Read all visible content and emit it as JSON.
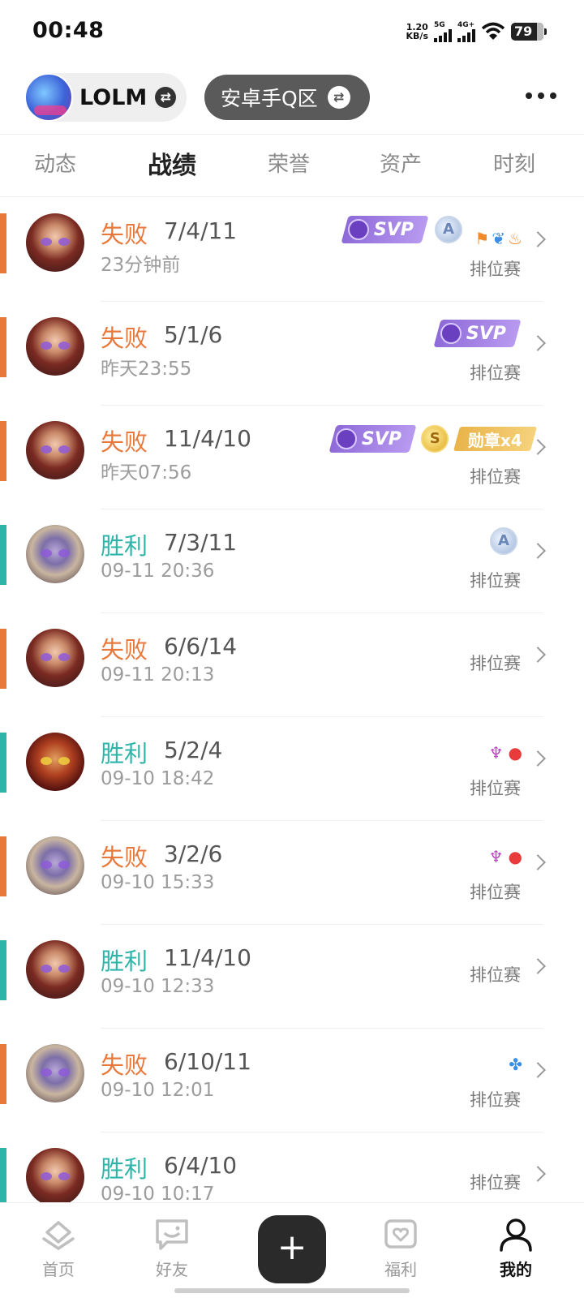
{
  "status_bar": {
    "time": "00:48",
    "net_speed": "1.20",
    "net_unit": "KB/s",
    "sim1": "5G",
    "sim2": "4G+",
    "battery": "79"
  },
  "header": {
    "game_name": "LOLM",
    "swap_glyph": "⇄",
    "server": "安卓手Q区",
    "more_icon": "more-horizontal-icon"
  },
  "tabs": [
    {
      "label": "动态",
      "active": false
    },
    {
      "label": "战绩",
      "active": true
    },
    {
      "label": "荣誉",
      "active": false
    },
    {
      "label": "资产",
      "active": false
    },
    {
      "label": "时刻",
      "active": false
    }
  ],
  "matches": [
    {
      "result": "失败",
      "kda": "7/4/11",
      "time": "23分钟前",
      "mode": "排位赛",
      "svp_text": "SVP",
      "coin_letter": "A"
    },
    {
      "result": "失败",
      "kda": "5/1/6",
      "time": "昨天23:55",
      "mode": "排位赛",
      "svp_text": "SVP"
    },
    {
      "result": "失败",
      "kda": "11/4/10",
      "time": "昨天07:56",
      "mode": "排位赛",
      "svp_text": "SVP",
      "coin_letter": "S",
      "medal_text": "勋章x4"
    },
    {
      "result": "胜利",
      "kda": "7/3/11",
      "time": "09-11 20:36",
      "mode": "排位赛",
      "coin_letter": "A"
    },
    {
      "result": "失败",
      "kda": "6/6/14",
      "time": "09-11 20:13",
      "mode": "排位赛"
    },
    {
      "result": "胜利",
      "kda": "5/2/4",
      "time": "09-10 18:42",
      "mode": "排位赛"
    },
    {
      "result": "失败",
      "kda": "3/2/6",
      "time": "09-10 15:33",
      "mode": "排位赛"
    },
    {
      "result": "胜利",
      "kda": "11/4/10",
      "time": "09-10 12:33",
      "mode": "排位赛"
    },
    {
      "result": "失败",
      "kda": "6/10/11",
      "time": "09-10 12:01",
      "mode": "排位赛"
    },
    {
      "result": "胜利",
      "kda": "6/4/10",
      "time": "09-10 10:17",
      "mode": "排位赛"
    }
  ],
  "colors": {
    "loss": "#e8793a",
    "win": "#2fb5a8",
    "svp": "#9a78e0",
    "medal": "#eec060"
  },
  "bottom_nav": [
    {
      "label": "首页",
      "icon": "home-icon"
    },
    {
      "label": "好友",
      "icon": "chat-icon"
    },
    {
      "label": "福利",
      "icon": "gift-heart-icon"
    },
    {
      "label": "我的",
      "icon": "profile-icon",
      "active": true
    }
  ],
  "plus_glyph": "+"
}
